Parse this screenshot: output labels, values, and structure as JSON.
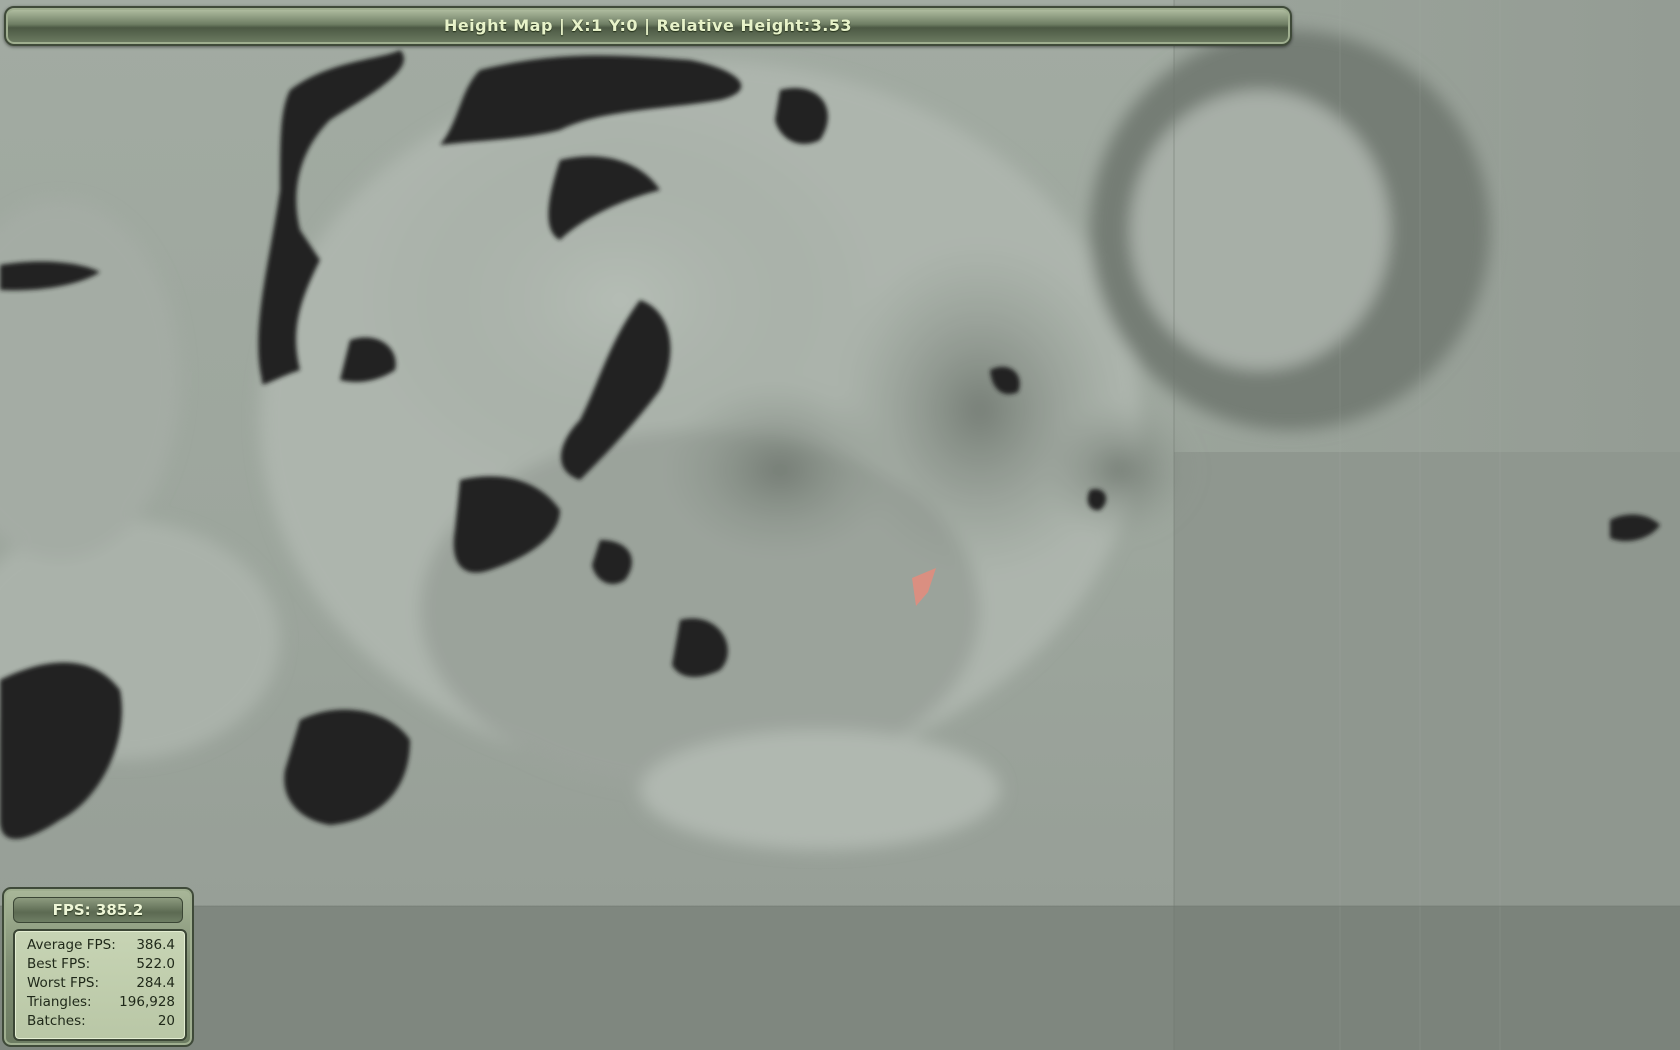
{
  "window": {
    "title": "Height Map | X:1 Y:0 | Relative Height:3.53"
  },
  "fps_panel": {
    "header": "FPS: 385.2",
    "stats": [
      {
        "label": "Average FPS:",
        "value": "386.4"
      },
      {
        "label": "Best FPS:",
        "value": "522.0"
      },
      {
        "label": "Worst FPS:",
        "value": "284.4"
      },
      {
        "label": "Triangles:",
        "value": "196,928"
      },
      {
        "label": "Batches:",
        "value": "20"
      }
    ]
  },
  "colors": {
    "terrain_gray": "#9da69d",
    "terrain_dark": "#1f221f",
    "ui_green": "#6f7e64",
    "ui_text": "#e7f2c9",
    "selection_marker": "#e58c7c"
  }
}
